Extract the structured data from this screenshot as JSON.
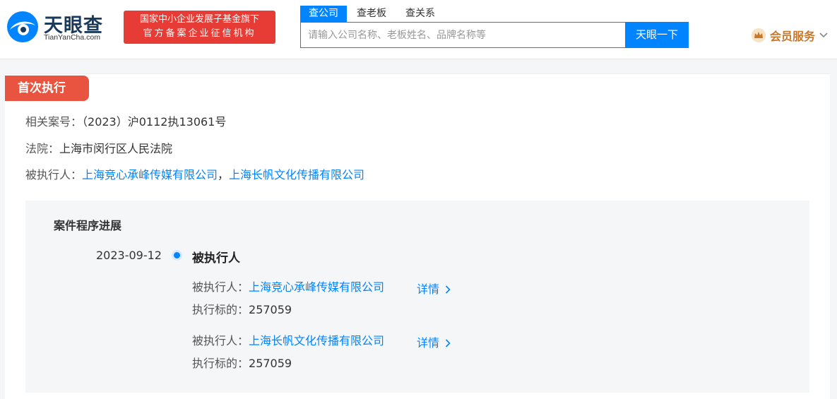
{
  "header": {
    "logo_text": "天眼查",
    "logo_sub": "TianYanCha.com",
    "badge_line1": "国家中小企业发展子基金旗下",
    "badge_line2": "官方备案企业征信机构",
    "search_tabs": [
      "查公司",
      "查老板",
      "查关系"
    ],
    "search_placeholder": "请输入公司名称、老板姓名、品牌名称等",
    "search_button": "天眼一下",
    "vip_label": "会员服务"
  },
  "section": {
    "tag": "首次执行",
    "case_no_label": "相关案号：",
    "case_no": "（2023）沪0112执13061号",
    "court_label": "法院：",
    "court": "上海市闵行区人民法院",
    "executed_label": "被执行人：",
    "executed_1": "上海竞心承峰传媒有限公司",
    "separator": "，",
    "executed_2": "上海长帆文化传播有限公司"
  },
  "progress": {
    "title": "案件程序进展",
    "date": "2023-09-12",
    "event": "被执行人",
    "entries": [
      {
        "party_label": "被执行人：",
        "party": "上海竞心承峰传媒有限公司",
        "detail": "详情",
        "amount_label": "执行标的：",
        "amount": "257059"
      },
      {
        "party_label": "被执行人：",
        "party": "上海长帆文化传播有限公司",
        "detail": "详情",
        "amount_label": "执行标的：",
        "amount": "257059"
      }
    ]
  },
  "colors": {
    "accent": "#0084ff",
    "tag_red": "#e8543f",
    "badge_red": "#e63c35",
    "vip_gold": "#c9782a"
  }
}
